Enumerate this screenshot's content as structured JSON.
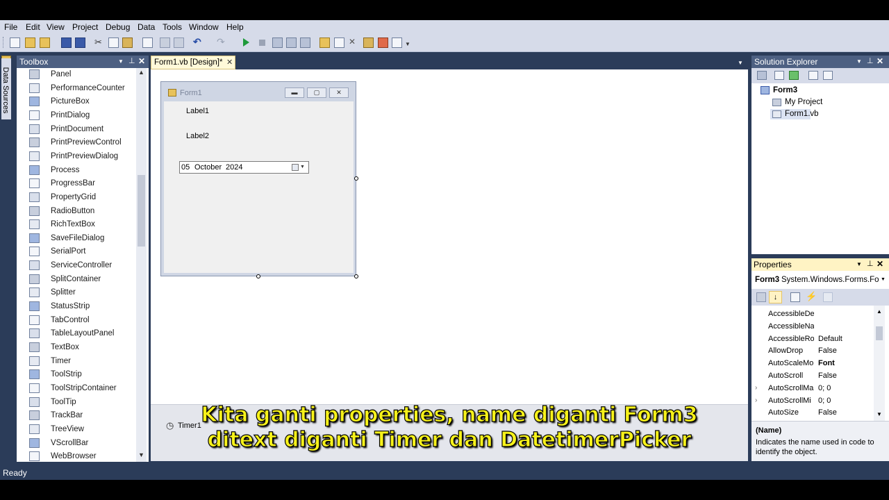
{
  "menu": [
    "File",
    "Edit",
    "View",
    "Project",
    "Debug",
    "Data",
    "Tools",
    "Window",
    "Help"
  ],
  "left_tab": "Data Sources",
  "toolbox": {
    "title": "Toolbox",
    "items": [
      "Panel",
      "PerformanceCounter",
      "PictureBox",
      "PrintDialog",
      "PrintDocument",
      "PrintPreviewControl",
      "PrintPreviewDialog",
      "Process",
      "ProgressBar",
      "PropertyGrid",
      "RadioButton",
      "RichTextBox",
      "SaveFileDialog",
      "SerialPort",
      "ServiceController",
      "SplitContainer",
      "Splitter",
      "StatusStrip",
      "TabControl",
      "TableLayoutPanel",
      "TextBox",
      "Timer",
      "ToolStrip",
      "ToolStripContainer",
      "ToolTip",
      "TrackBar",
      "TreeView",
      "VScrollBar",
      "WebBrowser"
    ]
  },
  "document": {
    "tab_label": "Form1.vb [Design]*",
    "form_caption": "Form1",
    "label1": "Label1",
    "label2": "Label2",
    "datepicker": {
      "day": "05",
      "month": "October",
      "year": "2024"
    },
    "tray_component": "Timer1"
  },
  "solution_explorer": {
    "title": "Solution Explorer",
    "project": "Form3",
    "children": [
      "My Project",
      "Form1.vb"
    ]
  },
  "properties": {
    "title": "Properties",
    "object_name": "Form3",
    "object_type": "System.Windows.Forms.Fo",
    "rows": [
      {
        "name": "AccessibleDe",
        "value": ""
      },
      {
        "name": "AccessibleNa",
        "value": ""
      },
      {
        "name": "AccessibleRol",
        "value": "Default"
      },
      {
        "name": "AllowDrop",
        "value": "False"
      },
      {
        "name": "AutoScaleMo",
        "value": "Font"
      },
      {
        "name": "AutoScroll",
        "value": "False"
      },
      {
        "name": "AutoScrollMa",
        "value": "0; 0"
      },
      {
        "name": "AutoScrollMi",
        "value": "0; 0"
      },
      {
        "name": "AutoSize",
        "value": "False"
      }
    ],
    "desc_title": "(Name)",
    "desc_text": "Indicates the name used in code to identify the object."
  },
  "status": "Ready",
  "subtitle": {
    "line1": "Kita ganti properties, name diganti Form3",
    "line2": "ditext diganti Timer dan DatetimerPicker"
  }
}
